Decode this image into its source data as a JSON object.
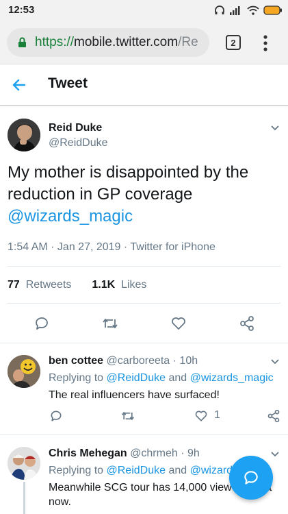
{
  "status_bar": {
    "time": "12:53"
  },
  "browser": {
    "url_scheme": "https://",
    "url_host": "mobile.twitter.com",
    "url_path": "/Re",
    "tab_count": "2"
  },
  "header": {
    "title": "Tweet"
  },
  "tweet": {
    "author_name": "Reid Duke",
    "author_handle": "@ReidDuke",
    "text_line1": "My mother is disappointed by the",
    "text_line2": "reduction in GP coverage",
    "mention": "@wizards_magic",
    "meta": "1:54 AM · Jan 27, 2019 · Twitter for iPhone",
    "retweets_count": "77",
    "retweets_label": "Retweets",
    "likes_count": "1.1K",
    "likes_label": "Likes"
  },
  "replies": [
    {
      "name": "ben cottee",
      "handle": "@carboreeta",
      "time": "· 10h",
      "replying_prefix": "Replying to ",
      "replying_to_1": "@ReidDuke",
      "replying_and": " and ",
      "replying_to_2": "@wizards_magic",
      "text": "The real influencers have surfaced!",
      "like_count": "1"
    },
    {
      "name": "Chris Mehegan",
      "handle": "@chrmeh",
      "time": "· 9h",
      "replying_prefix": "Replying to ",
      "replying_to_1": "@ReidDuke",
      "replying_and": " and ",
      "replying_to_2": "@wizard",
      "text_line1": "Meanwhile SCG tour has 14,000 view",
      "text_line1_tail": "t",
      "text_line2": "now."
    }
  ],
  "colors": {
    "accent": "#1da1f2",
    "link": "#1b95e0",
    "secure_green": "#188038",
    "muted": "#657786"
  }
}
